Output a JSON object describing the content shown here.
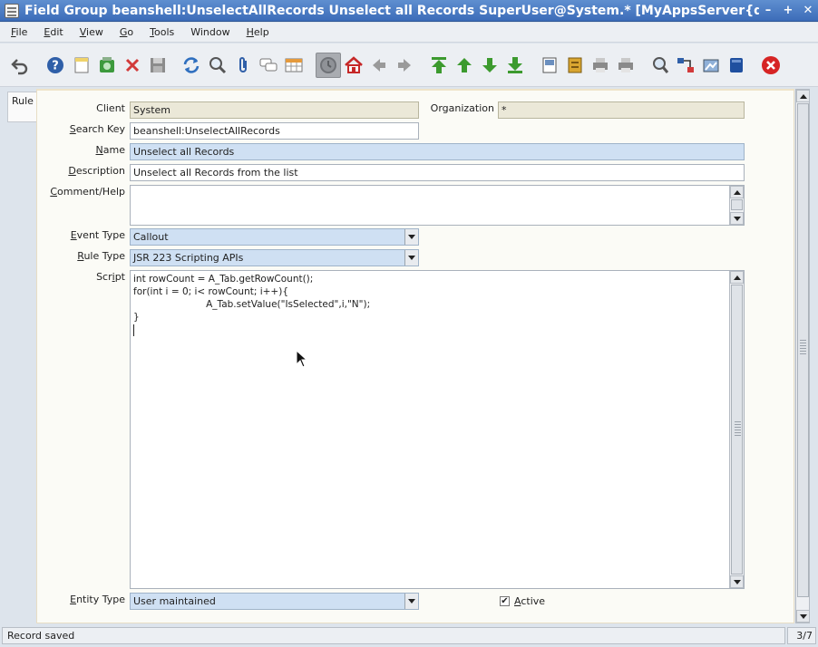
{
  "window": {
    "title": "Field Group  beanshell:UnselectAllRecords  Unselect all Records  SuperUser@System.* [MyAppsServer{d",
    "buttons": {
      "minimize": "–",
      "maximize": "+",
      "close": "✕"
    }
  },
  "menu": [
    {
      "label": "File",
      "mnemonic": "F",
      "rest": "ile"
    },
    {
      "label": "Edit",
      "mnemonic": "E",
      "rest": "dit"
    },
    {
      "label": "View",
      "mnemonic": "V",
      "rest": "iew"
    },
    {
      "label": "Go",
      "mnemonic": "G",
      "rest": "o"
    },
    {
      "label": "Tools",
      "mnemonic": "T",
      "rest": "ools"
    },
    {
      "label": "Window",
      "mnemonic": "",
      "rest": "Window"
    },
    {
      "label": "Help",
      "mnemonic": "H",
      "rest": "elp"
    }
  ],
  "toolbar": {
    "icons": [
      "undo-icon",
      "help-icon",
      "new-record-icon",
      "copy-record-icon",
      "delete-icon",
      "save-icon",
      "refresh-icon",
      "find-icon",
      "attachment-icon",
      "chat-icon",
      "grid-toggle-icon",
      "history-icon",
      "home-icon",
      "back-icon",
      "forward-icon",
      "first-record-icon",
      "previous-record-icon",
      "next-record-icon",
      "last-record-icon",
      "report-icon",
      "archive-icon",
      "print-preview-icon",
      "print-icon",
      "zoom-across-icon",
      "workflow-icon",
      "product-info-icon",
      "request-icon",
      "close-window-icon"
    ]
  },
  "tab": {
    "label": "Rule"
  },
  "form": {
    "client": {
      "label": "Client",
      "value": "System"
    },
    "organization": {
      "label": "Organization",
      "value": "*"
    },
    "search_key": {
      "label_m": "S",
      "label_rest": "earch Key",
      "value": "beanshell:UnselectAllRecords"
    },
    "name": {
      "label_m": "N",
      "label_rest": "ame",
      "value": "Unselect all Records"
    },
    "description": {
      "label_m": "D",
      "label_rest": "escription",
      "value": "Unselect all Records from the list"
    },
    "comment_help": {
      "label_m": "C",
      "label_rest": "omment/Help",
      "value": ""
    },
    "event_type": {
      "label_m": "E",
      "label_rest": "vent Type",
      "value": "Callout"
    },
    "rule_type": {
      "label_m": "R",
      "label_rest": "ule Type",
      "value": "JSR 223 Scripting APIs"
    },
    "script": {
      "label_pre": "Scr",
      "label_m": "i",
      "label_rest": "pt",
      "lines": [
        "int rowCount = A_Tab.getRowCount();",
        "for(int i = 0; i< rowCount; i++){",
        "                        A_Tab.setValue(\"IsSelected\",i,\"N\");",
        "}"
      ]
    },
    "entity_type": {
      "label_m": "E",
      "label_rest": "ntity Type",
      "value": "User maintained"
    },
    "active": {
      "label_m": "A",
      "label_rest": "ctive",
      "checked": true,
      "check_glyph": "✔"
    }
  },
  "status": {
    "message": "Record saved",
    "record_count": "3/7"
  }
}
